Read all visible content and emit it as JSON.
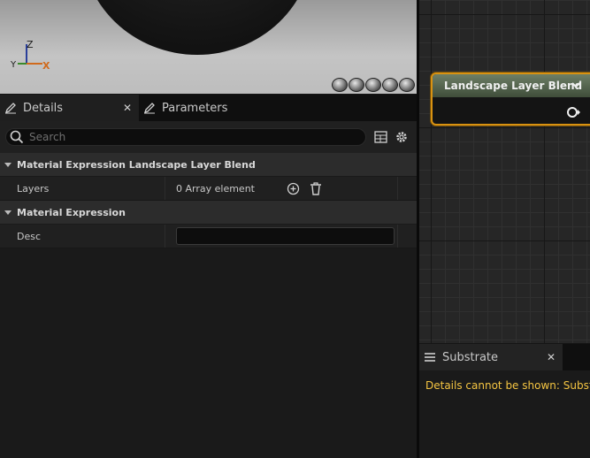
{
  "viewport": {
    "axis_z": "Z",
    "axis_y": "Y",
    "axis_x": "X",
    "shape_buttons": [
      "cylinder-icon",
      "sphere-icon",
      "plane-icon",
      "cube-icon",
      "custom-mesh-icon"
    ]
  },
  "details_panel": {
    "tabs": [
      {
        "label": "Details",
        "icon": "pencil-icon",
        "active": true,
        "closable": true
      },
      {
        "label": "Parameters",
        "icon": "pencil-icon",
        "active": false,
        "closable": false
      }
    ],
    "search": {
      "placeholder": "Search",
      "value": ""
    },
    "categories": [
      {
        "title": "Material Expression Landscape Layer Blend",
        "rows": [
          {
            "name": "Layers",
            "value": "0 Array element"
          }
        ]
      },
      {
        "title": "Material Expression",
        "rows": [
          {
            "name": "Desc",
            "value": ""
          }
        ]
      }
    ]
  },
  "graph": {
    "node": {
      "title": "Landscape Layer Blend"
    }
  },
  "substrate_panel": {
    "tab_label": "Substrate",
    "message": "Details cannot be shown: Substra"
  },
  "colors": {
    "node_border": "#d99211",
    "warning_text": "#f5c542",
    "axis_x": "#d06a1c"
  }
}
